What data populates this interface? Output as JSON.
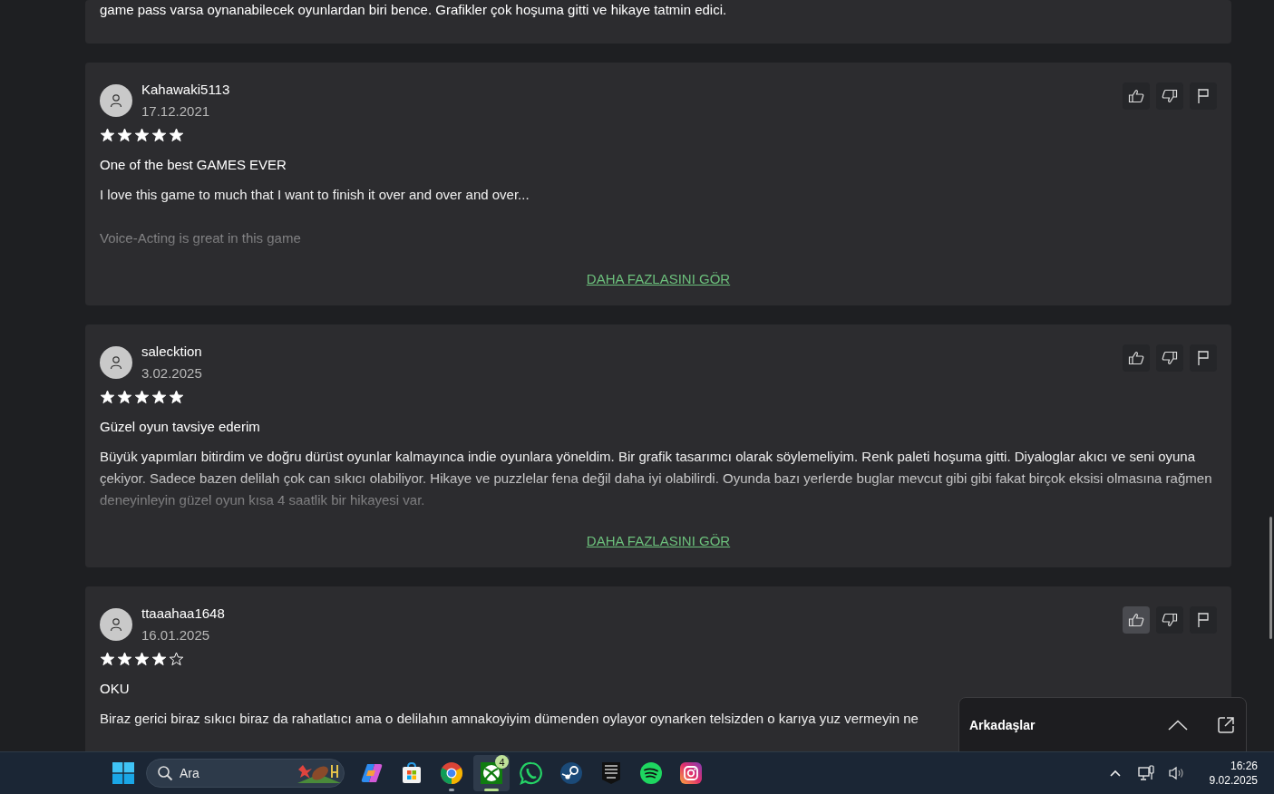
{
  "partial_review": {
    "body": "game pass varsa oynanabilecek oyunlardan biri bence. Grafikler çok hoşuma gitti ve hikaye tatmin edici."
  },
  "reviews": [
    {
      "author": "Kahawaki5113",
      "date": "17.12.2021",
      "stars": 5,
      "title": "One of the best GAMES EVER",
      "paragraphs": [
        "I love this game to much that I want to finish it over and over and over...",
        "Voice-Acting is great in this game"
      ],
      "more_link": "DAHA FAZLASINI GÖR",
      "like_highlighted": false
    },
    {
      "author": "salecktion",
      "date": "3.02.2025",
      "stars": 5,
      "title": "Güzel oyun tavsiye ederim",
      "paragraphs": [
        "Büyük yapımları bitirdim ve doğru dürüst oyunlar kalmayınca indie oyunlara yöneldim. Bir grafik tasarımcı olarak söylemeliyim. Renk paleti hoşuma gitti. Diyaloglar akıcı ve seni oyuna çekiyor. Sadece bazen delilah çok can sıkıcı olabiliyor. Hikaye ve puzzlelar fena değil daha iyi olabilirdi. Oyunda bazı yerlerde buglar mevcut gibi gibi fakat birçok eksisi olmasına rağmen deneyinleyin güzel oyun kısa 4 saatlik bir hikayesi var."
      ],
      "more_link": "DAHA FAZLASINI GÖR",
      "like_highlighted": false
    },
    {
      "author": "ttaaahaa1648",
      "date": "16.01.2025",
      "stars": 4,
      "title": "OKU",
      "paragraphs": [
        "Biraz gerici biraz sıkıcı biraz da rahatlatıcı ama o delilahın amnakoyiyim dümenden oylayor oynarken telsizden o karıya yuz vermeyin ne"
      ],
      "like_highlighted": true
    }
  ],
  "friends_panel": {
    "title": "Arkadaşlar"
  },
  "taskbar": {
    "search": {
      "placeholder": "Ara"
    },
    "apps": [
      {
        "kind": "copilot",
        "running": false,
        "active": false
      },
      {
        "kind": "store",
        "running": false,
        "active": false
      },
      {
        "kind": "chrome",
        "running": true,
        "active": false
      },
      {
        "kind": "xbox",
        "running": true,
        "active": true,
        "badge": "4"
      },
      {
        "kind": "whatsapp",
        "running": false,
        "active": false
      },
      {
        "kind": "steam",
        "running": false,
        "active": false
      },
      {
        "kind": "epic",
        "running": false,
        "active": false
      },
      {
        "kind": "spotify",
        "running": false,
        "active": false
      },
      {
        "kind": "instagram",
        "running": false,
        "active": false
      }
    ],
    "time": "16:26",
    "date": "9.02.2025"
  }
}
